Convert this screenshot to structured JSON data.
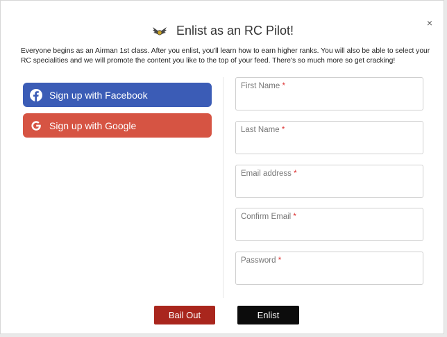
{
  "modal": {
    "title": "Enlist as an RC Pilot!",
    "close_label": "×",
    "intro": "Everyone begins as an Airman 1st class. After you enlist, you'll learn how to earn higher ranks. You will also be able to select your RC specialities and we will promote the content you like to the top of your feed. There's so much more so get cracking!",
    "title_icon": "pilot-wings-icon"
  },
  "social": {
    "facebook_label": "Sign up with Facebook",
    "google_label": "Sign up with Google",
    "facebook_color": "#3b5cb6",
    "google_color": "#d65443"
  },
  "form": {
    "required_marker": "*",
    "fields": [
      {
        "label": "First Name",
        "value": ""
      },
      {
        "label": "Last Name",
        "value": ""
      },
      {
        "label": "Email address",
        "value": ""
      },
      {
        "label": "Confirm Email",
        "value": ""
      },
      {
        "label": "Password",
        "value": ""
      }
    ]
  },
  "actions": {
    "bail_label": "Bail Out",
    "enlist_label": "Enlist",
    "bail_color": "#a9261d",
    "enlist_color": "#0c0c0c"
  }
}
